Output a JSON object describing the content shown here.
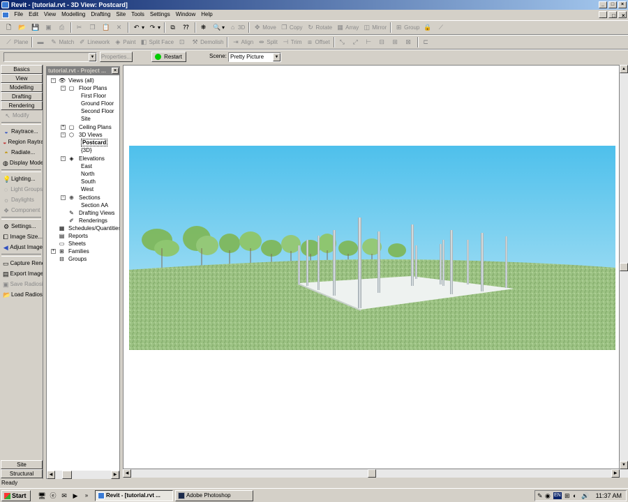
{
  "window": {
    "title": "Revit - [tutorial.rvt - 3D View: Postcard]"
  },
  "menu": [
    "File",
    "Edit",
    "View",
    "Modelling",
    "Drafting",
    "Site",
    "Tools",
    "Settings",
    "Window",
    "Help"
  ],
  "toolbar1": {
    "move": "Move",
    "copy": "Copy",
    "rotate": "Rotate",
    "array": "Array",
    "mirror": "Mirror",
    "group": "Group",
    "three_d": "3D"
  },
  "toolbar2": {
    "plane": "Plane",
    "match": "Match",
    "linework": "Linework",
    "paint": "Paint",
    "split_face": "Split Face",
    "demolish": "Demolish",
    "align": "Align",
    "split": "Split",
    "trim": "Trim",
    "offset": "Offset"
  },
  "options": {
    "properties": "Properties...",
    "restart": "Restart",
    "scene_label": "Scene:",
    "scene_value": "Pretty Picture"
  },
  "design_bar": {
    "tabs": [
      "Basics",
      "View",
      "Modelling",
      "Drafting",
      "Rendering"
    ],
    "modify": "Modify",
    "commands": [
      "Raytrace...",
      "Region Raytrace",
      "Radiate...",
      "Display Mode",
      "Lighting...",
      "Light Groups",
      "Daylights",
      "Component",
      "Settings...",
      "Image Size...",
      "Adjust Image",
      "Capture Rendering",
      "Export Image",
      "Save Radiosity",
      "Load Radiosity"
    ],
    "bottom_tabs": [
      "Site",
      "Structural"
    ]
  },
  "project_browser": {
    "title": "tutorial.rvt - Project ...",
    "tree": [
      {
        "label": "Views (all)"
      },
      {
        "label": "Floor Plans"
      },
      {
        "label": "First Floor"
      },
      {
        "label": "Ground Floor"
      },
      {
        "label": "Second Floor"
      },
      {
        "label": "Site"
      },
      {
        "label": "Ceiling Plans"
      },
      {
        "label": "3D Views"
      },
      {
        "label": "Postcard"
      },
      {
        "label": "{3D}"
      },
      {
        "label": "Elevations"
      },
      {
        "label": "East"
      },
      {
        "label": "North"
      },
      {
        "label": "South"
      },
      {
        "label": "West"
      },
      {
        "label": "Sections"
      },
      {
        "label": "Section AA"
      },
      {
        "label": "Drafting Views"
      },
      {
        "label": "Renderings"
      },
      {
        "label": "Schedules/Quantities"
      },
      {
        "label": "Reports"
      },
      {
        "label": "Sheets"
      },
      {
        "label": "Families"
      },
      {
        "label": "Groups"
      }
    ]
  },
  "status": {
    "text": "Ready"
  },
  "taskbar": {
    "start": "Start",
    "items": [
      "Revit - [tutorial.rvt ...",
      "Adobe Photoshop"
    ],
    "lang": "EN",
    "clock": "11:37 AM"
  }
}
